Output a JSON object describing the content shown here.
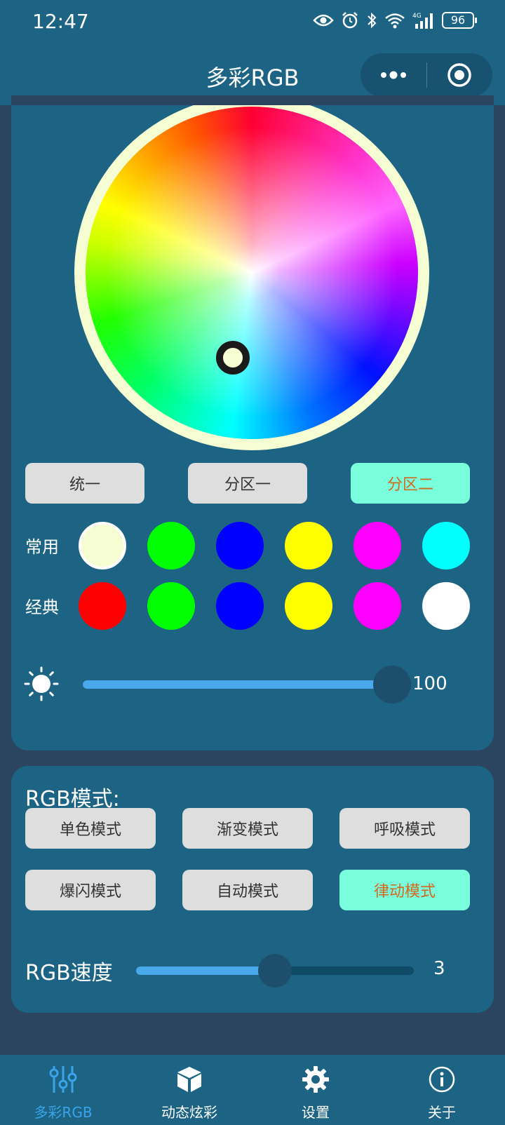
{
  "status_bar": {
    "time": "12:47",
    "battery": "96"
  },
  "nav": {
    "title": "多彩RGB"
  },
  "color_wheel": {
    "selected_color": "#f6fdd3"
  },
  "zones": [
    {
      "label": "统一",
      "active": false
    },
    {
      "label": "分区一",
      "active": false
    },
    {
      "label": "分区二",
      "active": true
    }
  ],
  "swatches": {
    "common_label": "常用",
    "common": [
      "#f6fdd3",
      "#00ff00",
      "#0000ff",
      "#ffff00",
      "#ff00ff",
      "#00ffff"
    ],
    "classic_label": "经典",
    "classic": [
      "#ff0000",
      "#00ff00",
      "#0000ff",
      "#ffff00",
      "#ff00ff",
      "#ffffff"
    ]
  },
  "brightness": {
    "value": "100",
    "fraction": 1.0
  },
  "rgb_mode": {
    "title": "RGB模式:",
    "modes": [
      {
        "label": "单色模式",
        "active": false
      },
      {
        "label": "渐变模式",
        "active": false
      },
      {
        "label": "呼吸模式",
        "active": false
      },
      {
        "label": "爆闪模式",
        "active": false
      },
      {
        "label": "自动模式",
        "active": false
      },
      {
        "label": "律动模式",
        "active": true
      }
    ]
  },
  "speed": {
    "label": "RGB速度",
    "value": "3",
    "fraction": 0.5
  },
  "tabs": [
    {
      "label": "多彩RGB",
      "icon": "sliders-icon",
      "active": true
    },
    {
      "label": "动态炫彩",
      "icon": "cube-icon",
      "active": false
    },
    {
      "label": "设置",
      "icon": "gear-icon",
      "active": false
    },
    {
      "label": "关于",
      "icon": "info-icon",
      "active": false
    }
  ],
  "colors": {
    "header": "#1d6484",
    "page_bg": "#2b4561",
    "accent": "#7affdc",
    "active_text": "#d2691e",
    "tab_active": "#3aa3ea",
    "slider_fill": "#4aa8ec"
  }
}
